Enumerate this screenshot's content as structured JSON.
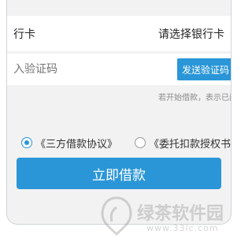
{
  "form": {
    "bank_card_label": "行卡",
    "bank_card_value": "请选择银行卡",
    "code_placeholder": "入验证码",
    "send_code_label": "发送验证码",
    "hint_text": "若开始借款，表示已阅"
  },
  "agreements": [
    {
      "label": "《三方借款协议》",
      "checked": true
    },
    {
      "label": "《委托扣款授权书》",
      "checked": false
    }
  ],
  "submit_label": "立即借款",
  "watermark": {
    "text": "绿茶软件园",
    "url": "www.33lc.com"
  },
  "colors": {
    "accent": "#2a96d8",
    "background": "#f2f2f2"
  }
}
